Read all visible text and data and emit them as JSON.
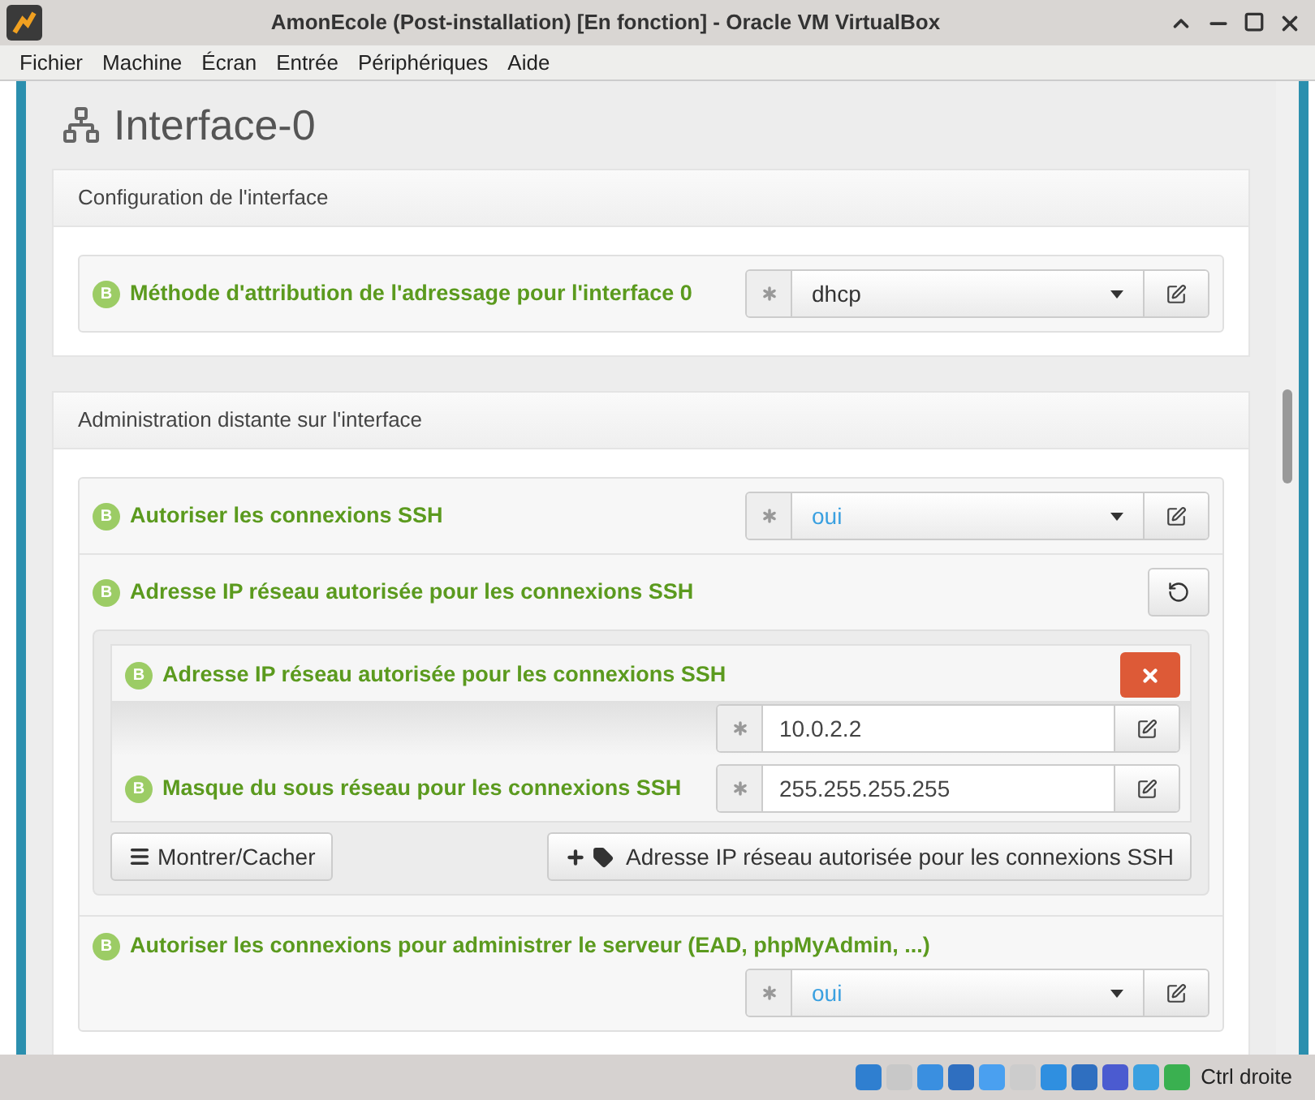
{
  "window": {
    "title": "AmonEcole (Post-installation) [En fonction] - Oracle VM VirtualBox"
  },
  "menu": [
    "Fichier",
    "Machine",
    "Écran",
    "Entrée",
    "Périphériques",
    "Aide"
  ],
  "page": {
    "title": "Interface-0"
  },
  "sections": [
    {
      "title": "Configuration de l'interface",
      "items": [
        {
          "kind": "select",
          "badge": "B",
          "label": "Méthode d'attribution de l'adressage pour l'interface 0",
          "value": "dhcp",
          "is_default": false
        }
      ]
    },
    {
      "title": "Administration distante sur l'interface",
      "items": [
        {
          "kind": "select",
          "badge": "B",
          "label": "Autoriser les connexions SSH",
          "value": "oui",
          "is_default": true
        },
        {
          "kind": "group",
          "badge": "B",
          "label": "Adresse IP réseau autorisée pour les connexions SSH",
          "entries": [
            {
              "badge": "B",
              "label": "Adresse IP réseau autorisée pour les connexions SSH",
              "value": "10.0.2.2",
              "removable": true
            },
            {
              "badge": "B",
              "label": "Masque du sous réseau pour les connexions SSH",
              "value": "255.255.255.255",
              "removable": false
            }
          ],
          "toggle_button": "Montrer/Cacher",
          "add_button": "Adresse IP réseau autorisée pour les connexions SSH"
        },
        {
          "kind": "select",
          "badge": "B",
          "label": "Autoriser les connexions pour administrer le serveur (EAD, phpMyAdmin, ...)",
          "value": "oui",
          "is_default": true
        }
      ]
    }
  ],
  "status_bar": {
    "hint": "Ctrl droite"
  }
}
